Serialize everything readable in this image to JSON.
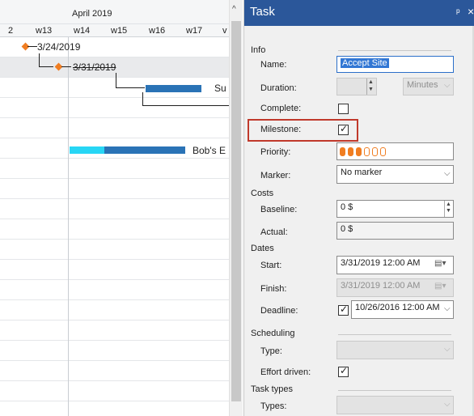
{
  "gantt": {
    "month": "April 2019",
    "weeks": [
      "2",
      "w13",
      "w14",
      "w15",
      "w16",
      "w17",
      "v"
    ],
    "rows": [
      {
        "label": "3/24/2019"
      },
      {
        "label": "3/31/2019"
      },
      {
        "label": "Su"
      },
      {
        "label": ""
      },
      {
        "label": ""
      },
      {
        "label": ""
      },
      {
        "label": "Bob's E"
      }
    ]
  },
  "pane": {
    "title": "Task",
    "pin_glyph": "ᵖ",
    "close_glyph": "×",
    "sections": {
      "info": "Info",
      "costs": "Costs",
      "dates": "Dates",
      "scheduling": "Scheduling",
      "task_types": "Task types"
    },
    "fields": {
      "name_label": "Name:",
      "name_value": "Accept Site",
      "duration_label": "Duration:",
      "duration_value": "",
      "duration_unit": "Minutes",
      "complete_label": "Complete:",
      "complete_checked": false,
      "milestone_label": "Milestone:",
      "milestone_checked": true,
      "priority_label": "Priority:",
      "priority_level": 3,
      "priority_max": 6,
      "marker_label": "Marker:",
      "marker_value": "No marker",
      "baseline_label": "Baseline:",
      "baseline_value": "0 $",
      "actual_label": "Actual:",
      "actual_value": "0 $",
      "start_label": "Start:",
      "start_value": "3/31/2019 12:00 AM",
      "finish_label": "Finish:",
      "finish_value": "3/31/2019 12:00 AM",
      "deadline_label": "Deadline:",
      "deadline_checked": true,
      "deadline_value": "10/26/2016 12:00 AM",
      "type_label": "Type:",
      "type_value": "",
      "effort_label": "Effort driven:",
      "effort_checked": true,
      "types_label": "Types:",
      "types_value": ""
    }
  },
  "colors": {
    "title_bar": "#2b579a",
    "milestone": "#f07d21",
    "bar": "#2a73b6",
    "bar_progress": "#27d6f5",
    "highlight": "#c0392b",
    "selection": "#3277d4"
  }
}
